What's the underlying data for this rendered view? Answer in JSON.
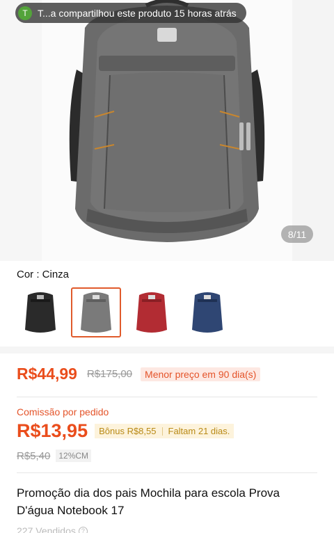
{
  "share": {
    "avatar_initial": "T",
    "text": "T...a compartilhou este produto 15 horas atrás"
  },
  "gallery": {
    "counter": "8/11"
  },
  "color": {
    "label": "Cor : Cinza",
    "options": [
      {
        "name": "black",
        "hex": "#2a2a2a",
        "selected": false
      },
      {
        "name": "gray",
        "hex": "#7a7a7a",
        "selected": true
      },
      {
        "name": "red",
        "hex": "#b22c33",
        "selected": false
      },
      {
        "name": "navy",
        "hex": "#2f4673",
        "selected": false
      }
    ]
  },
  "price": {
    "current": "R$44,99",
    "original": "R$175,00",
    "badge": "Menor preço em 90 dia(s)"
  },
  "commission": {
    "label": "Comissão por pedido",
    "value": "R$13,95",
    "bonus": "Bônus R$8,55",
    "remaining": "Faltam 21 dias.",
    "old_value": "R$5,40",
    "rate": "12%CM"
  },
  "product": {
    "title": "Promoção dia dos pais Mochila para escola Prova D'água Notebook 17",
    "sold": "227 Vendidos"
  },
  "colors": {
    "accent": "#ea4d1c",
    "bonus_bg": "#fdf3dc",
    "badge_bg": "#fde8e2"
  }
}
